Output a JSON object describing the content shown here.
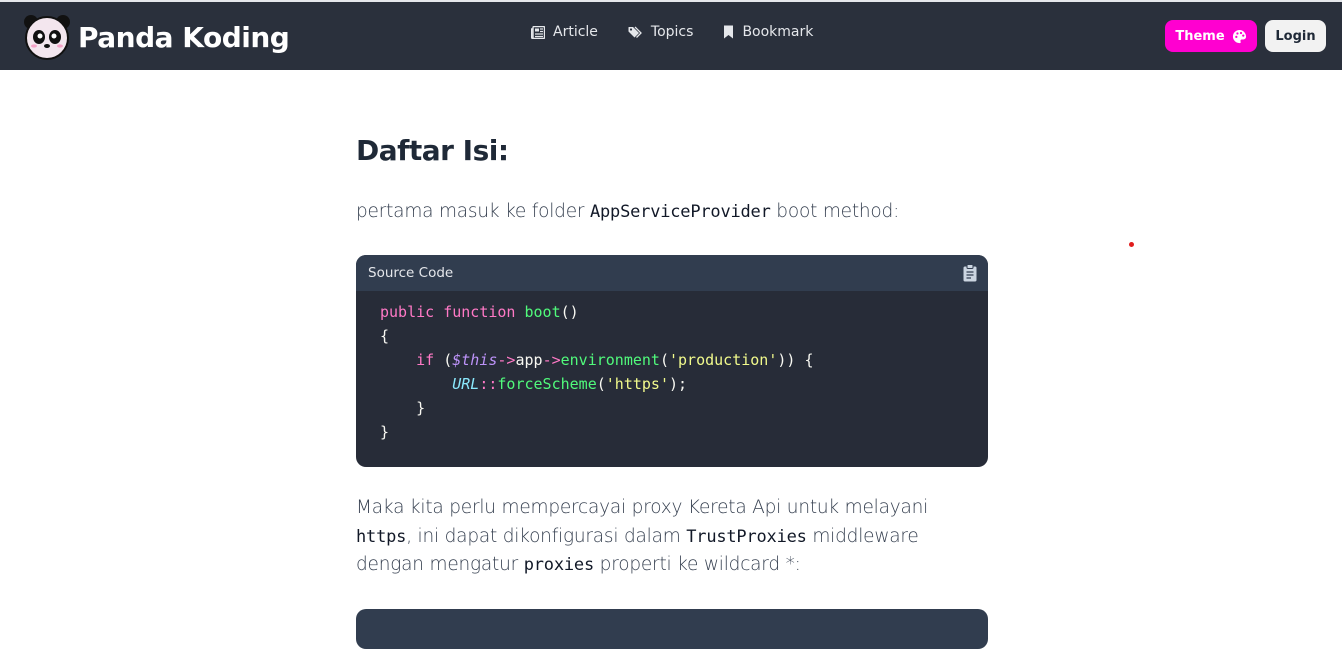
{
  "brand": {
    "name": "Panda Koding",
    "logo_icon": "panda-icon"
  },
  "nav": {
    "items": [
      {
        "label": "Article",
        "icon": "newspaper-icon"
      },
      {
        "label": "Topics",
        "icon": "tags-icon"
      },
      {
        "label": "Bookmark",
        "icon": "bookmark-icon"
      }
    ],
    "theme_label": "Theme",
    "theme_icon": "palette-icon",
    "login_label": "Login"
  },
  "colors": {
    "navbar": "#2a303c",
    "theme_button": "#ff00d0",
    "code_background": "#272c38",
    "code_header": "#313d4f"
  },
  "article": {
    "heading": "Daftar Isi:",
    "p1_before": "pertama masuk ke folder ",
    "p1_code": "AppServiceProvider",
    "p1_after": " boot method:",
    "code_block": {
      "title": "Source Code",
      "copy_icon": "clipboard-icon",
      "lines": [
        "public function boot()",
        "{",
        "    if ($this->app->environment('production')) {",
        "        URL::forceScheme('https');",
        "    }",
        "}"
      ]
    },
    "p2_part1": "Maka kita perlu mempercayai proxy Kereta Api untuk melayani ",
    "p2_code1": "https",
    "p2_part2": ", ini dapat dikonfigurasi dalam ",
    "p2_code2": "TrustProxies",
    "p2_part3": " middleware dengan mengatur ",
    "p2_code3": "proxies",
    "p2_part4": " properti ke wildcard *:"
  }
}
